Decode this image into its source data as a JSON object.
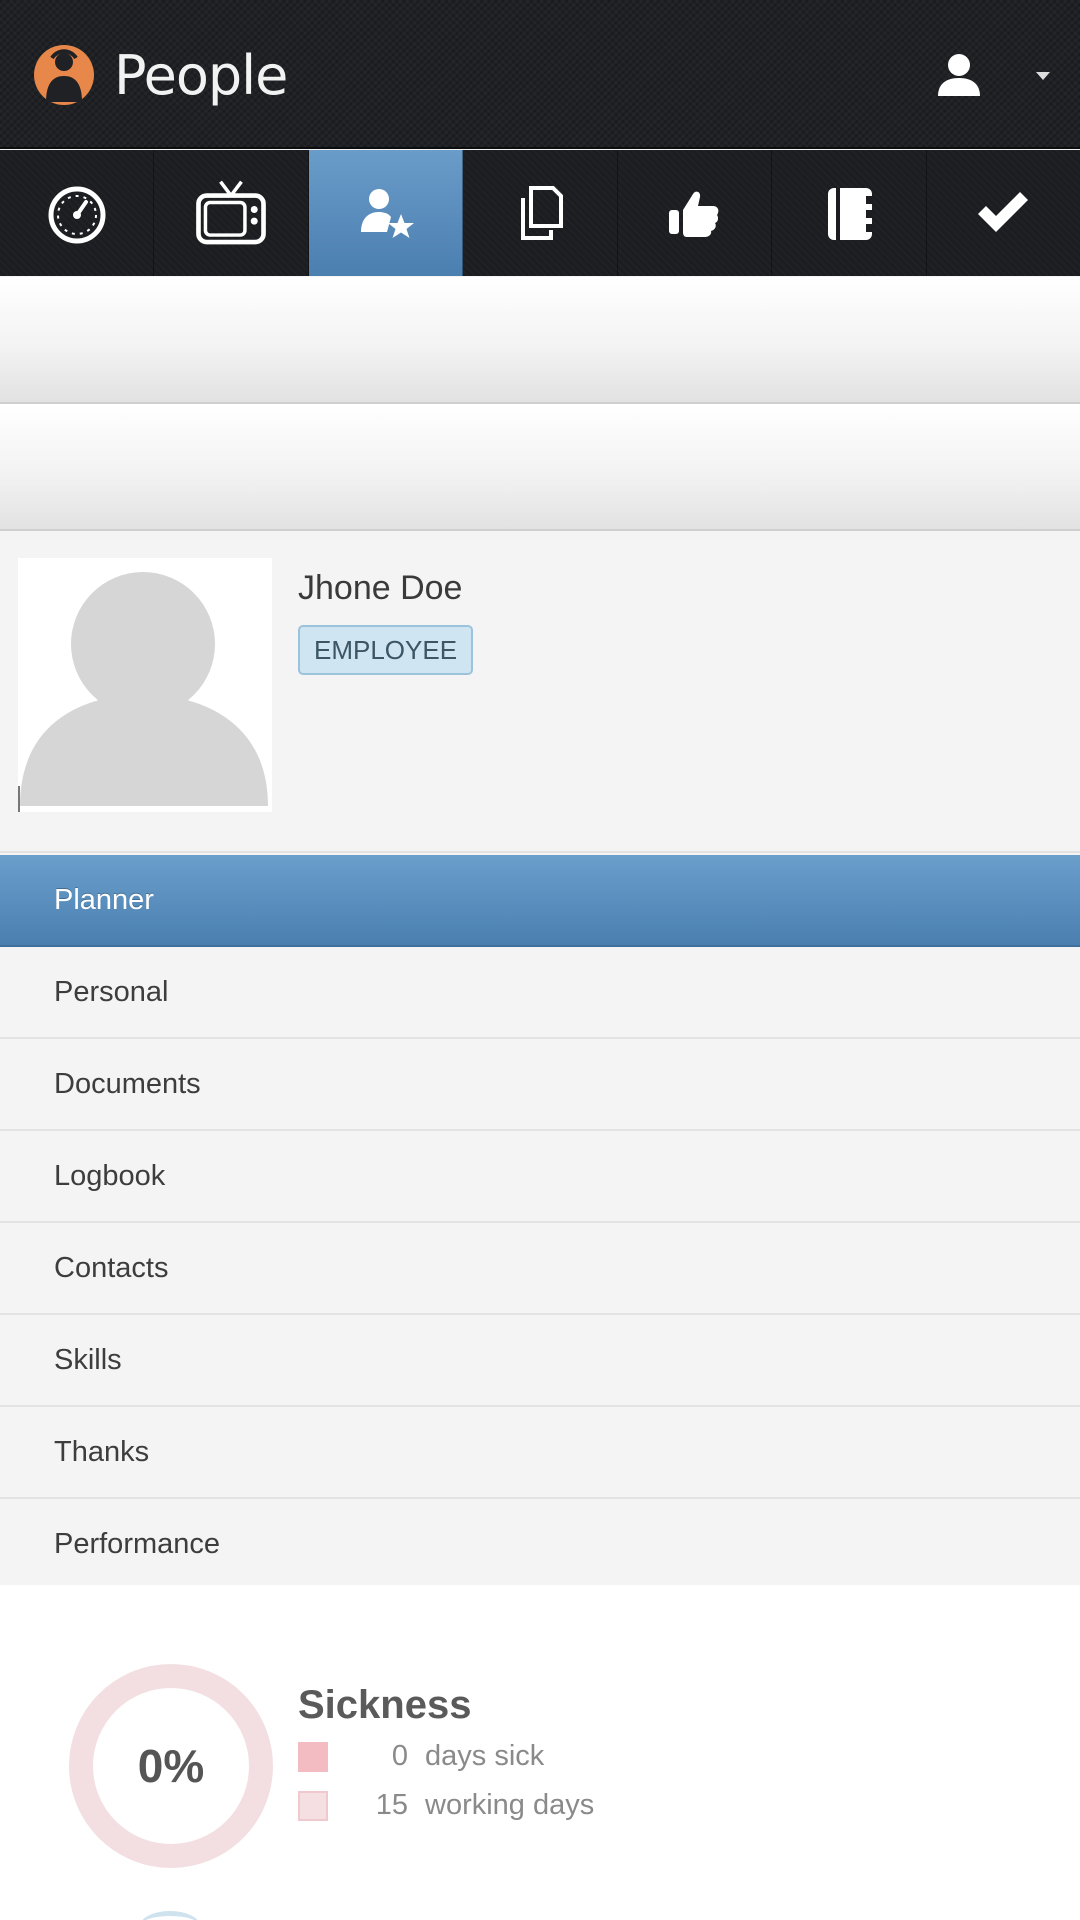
{
  "header": {
    "app_title": "People",
    "logo_icon": "person-logo-icon",
    "brand_color": "#e8874a",
    "user_icon": "user-icon",
    "caret_icon": "caret-down-icon"
  },
  "nav": {
    "active_index": 2,
    "active_color": "#5a8dbd",
    "items": [
      {
        "icon": "dashboard-icon"
      },
      {
        "icon": "tv-icon"
      },
      {
        "icon": "user-star-icon"
      },
      {
        "icon": "copy-documents-icon"
      },
      {
        "icon": "thumbs-up-icon"
      },
      {
        "icon": "notebook-icon"
      },
      {
        "icon": "check-icon"
      }
    ]
  },
  "profile": {
    "name": "Jhone Doe",
    "role": "EMPLOYEE",
    "avatar_icon": "avatar-placeholder-icon"
  },
  "menu": {
    "active": "Planner",
    "items": [
      "Planner",
      "Personal",
      "Documents",
      "Logbook",
      "Contacts",
      "Skills",
      "Thanks",
      "Performance"
    ]
  },
  "sickness": {
    "percent_label": "0%",
    "percent": 0,
    "title": "Sickness",
    "rows": [
      {
        "value": "0",
        "label": "days sick",
        "color": "#f2bcc2"
      },
      {
        "value": "15",
        "label": "working days",
        "color": "#f6dfe2"
      }
    ]
  }
}
